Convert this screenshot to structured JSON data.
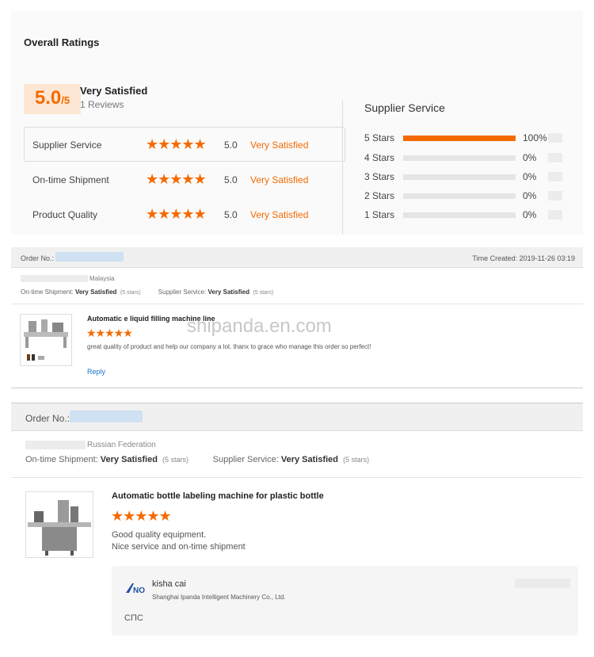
{
  "overall": {
    "title": "Overall Ratings",
    "score": "5.0",
    "score_suffix": "/5",
    "score_label": "Very Satisfied",
    "reviews": "1 Reviews",
    "rows": [
      {
        "label": "Supplier Service",
        "stars": "★★★★★",
        "value": "5.0",
        "text": "Very Satisfied"
      },
      {
        "label": "On-time Shipment",
        "stars": "★★★★★",
        "value": "5.0",
        "text": "Very Satisfied"
      },
      {
        "label": "Product Quality",
        "stars": "★★★★★",
        "value": "5.0",
        "text": "Very Satisfied"
      }
    ]
  },
  "supplier_service": {
    "title": "Supplier Service",
    "distribution": [
      {
        "label": "5 Stars",
        "pct": "100%",
        "fraction": 1.0
      },
      {
        "label": "4 Stars",
        "pct": "0%",
        "fraction": 0
      },
      {
        "label": "3 Stars",
        "pct": "0%",
        "fraction": 0
      },
      {
        "label": "2 Stars",
        "pct": "0%",
        "fraction": 0
      },
      {
        "label": "1 Stars",
        "pct": "0%",
        "fraction": 0
      }
    ]
  },
  "order1": {
    "order_no_label": "Order No.:",
    "time_created": "Time Created: 2019-11-26 03:19",
    "country": "Malaysia",
    "ontime_label": "On-time Shipment:",
    "ontime_value": "Very Satisfied",
    "ontime_stars": "(5 stars)",
    "supplier_label": "Supplier Service:",
    "supplier_value": "Very Satisfied",
    "supplier_stars": "(5 stars)",
    "product_title": "Automatic e liquid filling machine line",
    "stars": "★★★★★",
    "comment": "great quality of product and help our company a lot. thanx to grace who manage this order so perfect!",
    "reply_label": "Reply"
  },
  "watermark": "shipanda.en.com",
  "order2": {
    "order_no_label": "Order No.:",
    "country": "Russian Federation",
    "ontime_label": "On-time Shipment:",
    "ontime_value": "Very Satisfied",
    "ontime_stars": "(5 stars)",
    "supplier_label": "Supplier Service:",
    "supplier_value": "Very Satisfied",
    "supplier_stars": "(5 stars)",
    "product_title": "Automatic bottle labeling machine for plastic bottle",
    "stars": "★★★★★",
    "comment_line1": "Good quality equipment.",
    "comment_line2": "Nice service and on-time shipment",
    "reply": {
      "name": "kisha cai",
      "company": "Shanghai Ipanda Intelligent Machinery Co., Ltd.",
      "text": "СПС",
      "logo_text": "NO"
    }
  },
  "colors": {
    "accent": "#f56a00",
    "link": "#1a70c8"
  }
}
